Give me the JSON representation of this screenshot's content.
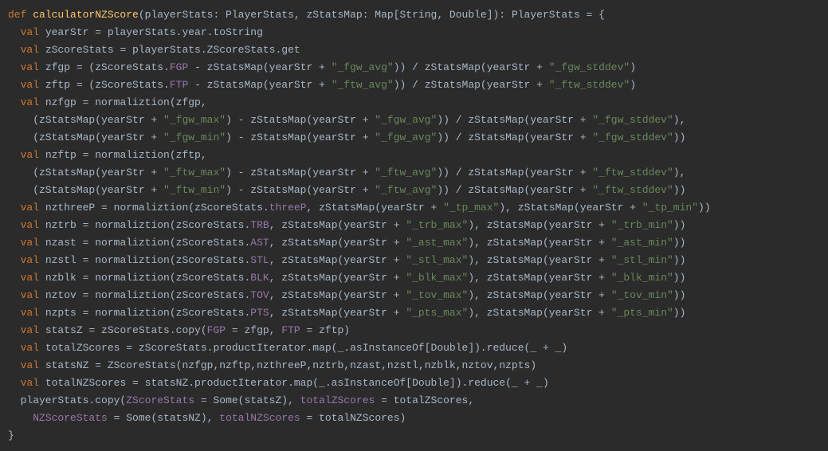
{
  "code": {
    "lang": "scala",
    "function_name": "calculatorNZScore",
    "tokens": [
      {
        "t": "def ",
        "c": "kw"
      },
      {
        "t": "calculatorNZScore",
        "c": "fn"
      },
      {
        "t": "(playerStats: PlayerStats, zStatsMap: Map[",
        "c": "punc"
      },
      {
        "t": "String",
        "c": "type"
      },
      {
        "t": ", ",
        "c": "punc"
      },
      {
        "t": "Double",
        "c": "type"
      },
      {
        "t": "]): PlayerStats = {\n",
        "c": "punc"
      },
      {
        "t": "  ",
        "c": ""
      },
      {
        "t": "val ",
        "c": "kw"
      },
      {
        "t": "yearStr = playerStats.year.toString\n",
        "c": "punc"
      },
      {
        "t": "  ",
        "c": ""
      },
      {
        "t": "val ",
        "c": "kw"
      },
      {
        "t": "zScoreStats = playerStats.ZScoreStats.get\n",
        "c": "punc"
      },
      {
        "t": "  ",
        "c": ""
      },
      {
        "t": "val ",
        "c": "kw"
      },
      {
        "t": "zfgp = (zScoreStats.",
        "c": "punc"
      },
      {
        "t": "FGP",
        "c": "id"
      },
      {
        "t": " - zStatsMap(yearStr + ",
        "c": "punc"
      },
      {
        "t": "\"_fgw_avg\"",
        "c": "str"
      },
      {
        "t": ")) / zStatsMap(yearStr + ",
        "c": "punc"
      },
      {
        "t": "\"_fgw_stddev\"",
        "c": "str"
      },
      {
        "t": ")\n",
        "c": "punc"
      },
      {
        "t": "  ",
        "c": ""
      },
      {
        "t": "val ",
        "c": "kw"
      },
      {
        "t": "zftp = (zScoreStats.",
        "c": "punc"
      },
      {
        "t": "FTP",
        "c": "id"
      },
      {
        "t": " - zStatsMap(yearStr + ",
        "c": "punc"
      },
      {
        "t": "\"_ftw_avg\"",
        "c": "str"
      },
      {
        "t": ")) / zStatsMap(yearStr + ",
        "c": "punc"
      },
      {
        "t": "\"_ftw_stddev\"",
        "c": "str"
      },
      {
        "t": ")\n",
        "c": "punc"
      },
      {
        "t": "  ",
        "c": ""
      },
      {
        "t": "val ",
        "c": "kw"
      },
      {
        "t": "nzfgp = normaliztion(zfgp,\n",
        "c": "punc"
      },
      {
        "t": "    (zStatsMap(yearStr + ",
        "c": "punc"
      },
      {
        "t": "\"_fgw_max\"",
        "c": "str"
      },
      {
        "t": ") - zStatsMap(yearStr + ",
        "c": "punc"
      },
      {
        "t": "\"_fgw_avg\"",
        "c": "str"
      },
      {
        "t": ")) / zStatsMap(yearStr + ",
        "c": "punc"
      },
      {
        "t": "\"_fgw_stddev\"",
        "c": "str"
      },
      {
        "t": "),\n",
        "c": "punc"
      },
      {
        "t": "    (zStatsMap(yearStr + ",
        "c": "punc"
      },
      {
        "t": "\"_fgw_min\"",
        "c": "str"
      },
      {
        "t": ") - zStatsMap(yearStr + ",
        "c": "punc"
      },
      {
        "t": "\"_fgw_avg\"",
        "c": "str"
      },
      {
        "t": ")) / zStatsMap(yearStr + ",
        "c": "punc"
      },
      {
        "t": "\"_fgw_stddev\"",
        "c": "str"
      },
      {
        "t": "))\n",
        "c": "punc"
      },
      {
        "t": "  ",
        "c": ""
      },
      {
        "t": "val ",
        "c": "kw"
      },
      {
        "t": "nzftp = normaliztion(zftp,\n",
        "c": "punc"
      },
      {
        "t": "    (zStatsMap(yearStr + ",
        "c": "punc"
      },
      {
        "t": "\"_ftw_max\"",
        "c": "str"
      },
      {
        "t": ") - zStatsMap(yearStr + ",
        "c": "punc"
      },
      {
        "t": "\"_ftw_avg\"",
        "c": "str"
      },
      {
        "t": ")) / zStatsMap(yearStr + ",
        "c": "punc"
      },
      {
        "t": "\"_ftw_stddev\"",
        "c": "str"
      },
      {
        "t": "),\n",
        "c": "punc"
      },
      {
        "t": "    (zStatsMap(yearStr + ",
        "c": "punc"
      },
      {
        "t": "\"_ftw_min\"",
        "c": "str"
      },
      {
        "t": ") - zStatsMap(yearStr + ",
        "c": "punc"
      },
      {
        "t": "\"_ftw_avg\"",
        "c": "str"
      },
      {
        "t": ")) / zStatsMap(yearStr + ",
        "c": "punc"
      },
      {
        "t": "\"_ftw_stddev\"",
        "c": "str"
      },
      {
        "t": "))\n",
        "c": "punc"
      },
      {
        "t": "  ",
        "c": ""
      },
      {
        "t": "val ",
        "c": "kw"
      },
      {
        "t": "nzthreeP = normaliztion(zScoreStats.",
        "c": "punc"
      },
      {
        "t": "threeP",
        "c": "id"
      },
      {
        "t": ", zStatsMap(yearStr + ",
        "c": "punc"
      },
      {
        "t": "\"_tp_max\"",
        "c": "str"
      },
      {
        "t": "), zStatsMap(yearStr + ",
        "c": "punc"
      },
      {
        "t": "\"_tp_min\"",
        "c": "str"
      },
      {
        "t": "))\n",
        "c": "punc"
      },
      {
        "t": "  ",
        "c": ""
      },
      {
        "t": "val ",
        "c": "kw"
      },
      {
        "t": "nztrb = normaliztion(zScoreStats.",
        "c": "punc"
      },
      {
        "t": "TRB",
        "c": "id"
      },
      {
        "t": ", zStatsMap(yearStr + ",
        "c": "punc"
      },
      {
        "t": "\"_trb_max\"",
        "c": "str"
      },
      {
        "t": "), zStatsMap(yearStr + ",
        "c": "punc"
      },
      {
        "t": "\"_trb_min\"",
        "c": "str"
      },
      {
        "t": "))\n",
        "c": "punc"
      },
      {
        "t": "  ",
        "c": ""
      },
      {
        "t": "val ",
        "c": "kw"
      },
      {
        "t": "nzast = normaliztion(zScoreStats.",
        "c": "punc"
      },
      {
        "t": "AST",
        "c": "id"
      },
      {
        "t": ", zStatsMap(yearStr + ",
        "c": "punc"
      },
      {
        "t": "\"_ast_max\"",
        "c": "str"
      },
      {
        "t": "), zStatsMap(yearStr + ",
        "c": "punc"
      },
      {
        "t": "\"_ast_min\"",
        "c": "str"
      },
      {
        "t": "))\n",
        "c": "punc"
      },
      {
        "t": "  ",
        "c": ""
      },
      {
        "t": "val ",
        "c": "kw"
      },
      {
        "t": "nzstl = normaliztion(zScoreStats.",
        "c": "punc"
      },
      {
        "t": "STL",
        "c": "id"
      },
      {
        "t": ", zStatsMap(yearStr + ",
        "c": "punc"
      },
      {
        "t": "\"_stl_max\"",
        "c": "str"
      },
      {
        "t": "), zStatsMap(yearStr + ",
        "c": "punc"
      },
      {
        "t": "\"_stl_min\"",
        "c": "str"
      },
      {
        "t": "))\n",
        "c": "punc"
      },
      {
        "t": "  ",
        "c": ""
      },
      {
        "t": "val ",
        "c": "kw"
      },
      {
        "t": "nzblk = normaliztion(zScoreStats.",
        "c": "punc"
      },
      {
        "t": "BLK",
        "c": "id"
      },
      {
        "t": ", zStatsMap(yearStr + ",
        "c": "punc"
      },
      {
        "t": "\"_blk_max\"",
        "c": "str"
      },
      {
        "t": "), zStatsMap(yearStr + ",
        "c": "punc"
      },
      {
        "t": "\"_blk_min\"",
        "c": "str"
      },
      {
        "t": "))\n",
        "c": "punc"
      },
      {
        "t": "  ",
        "c": ""
      },
      {
        "t": "val ",
        "c": "kw"
      },
      {
        "t": "nztov = normaliztion(zScoreStats.",
        "c": "punc"
      },
      {
        "t": "TOV",
        "c": "id"
      },
      {
        "t": ", zStatsMap(yearStr + ",
        "c": "punc"
      },
      {
        "t": "\"_tov_max\"",
        "c": "str"
      },
      {
        "t": "), zStatsMap(yearStr + ",
        "c": "punc"
      },
      {
        "t": "\"_tov_min\"",
        "c": "str"
      },
      {
        "t": "))\n",
        "c": "punc"
      },
      {
        "t": "  ",
        "c": ""
      },
      {
        "t": "val ",
        "c": "kw"
      },
      {
        "t": "nzpts = normaliztion(zScoreStats.",
        "c": "punc"
      },
      {
        "t": "PTS",
        "c": "id"
      },
      {
        "t": ", zStatsMap(yearStr + ",
        "c": "punc"
      },
      {
        "t": "\"_pts_max\"",
        "c": "str"
      },
      {
        "t": "), zStatsMap(yearStr + ",
        "c": "punc"
      },
      {
        "t": "\"_pts_min\"",
        "c": "str"
      },
      {
        "t": "))\n",
        "c": "punc"
      },
      {
        "t": "  ",
        "c": ""
      },
      {
        "t": "val ",
        "c": "kw"
      },
      {
        "t": "statsZ = zScoreStats.copy(",
        "c": "punc"
      },
      {
        "t": "FGP",
        "c": "id"
      },
      {
        "t": " = zfgp, ",
        "c": "punc"
      },
      {
        "t": "FTP",
        "c": "id"
      },
      {
        "t": " = zftp)\n",
        "c": "punc"
      },
      {
        "t": "  ",
        "c": ""
      },
      {
        "t": "val ",
        "c": "kw"
      },
      {
        "t": "totalZScores = zScoreStats.productIterator.map(_.asInstanceOf[",
        "c": "punc"
      },
      {
        "t": "Double",
        "c": "type"
      },
      {
        "t": "]).reduce(_ + _)\n",
        "c": "punc"
      },
      {
        "t": "  ",
        "c": ""
      },
      {
        "t": "val ",
        "c": "kw"
      },
      {
        "t": "statsNZ = ZScoreStats(nzfgp,nzftp,nzthreeP,nztrb,nzast,nzstl,nzblk,nztov,nzpts)\n",
        "c": "punc"
      },
      {
        "t": "  ",
        "c": ""
      },
      {
        "t": "val ",
        "c": "kw"
      },
      {
        "t": "totalNZScores = statsNZ.productIterator.map(_.asInstanceOf[",
        "c": "punc"
      },
      {
        "t": "Double",
        "c": "type"
      },
      {
        "t": "]).reduce(_ + _)\n",
        "c": "punc"
      },
      {
        "t": "  playerStats.copy(",
        "c": "punc"
      },
      {
        "t": "ZScoreStats",
        "c": "id"
      },
      {
        "t": " = Some(statsZ), ",
        "c": "punc"
      },
      {
        "t": "totalZScores",
        "c": "id"
      },
      {
        "t": " = totalZScores,\n",
        "c": "punc"
      },
      {
        "t": "    ",
        "c": ""
      },
      {
        "t": "NZScoreStats",
        "c": "id"
      },
      {
        "t": " = Some(statsNZ), ",
        "c": "punc"
      },
      {
        "t": "totalNZScores",
        "c": "id"
      },
      {
        "t": " = totalNZScores)\n",
        "c": "punc"
      },
      {
        "t": "}",
        "c": "punc"
      }
    ]
  }
}
